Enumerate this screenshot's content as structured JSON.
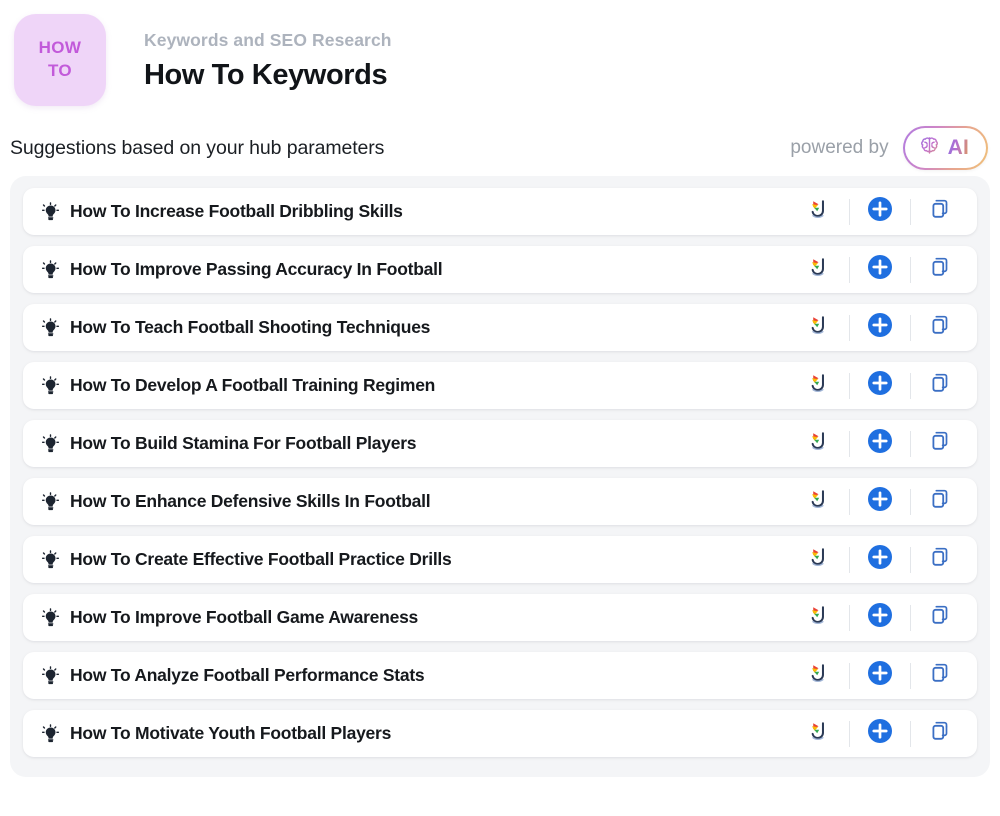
{
  "header": {
    "badge_line1": "HOW",
    "badge_line2": "TO",
    "eyebrow": "Keywords and SEO Research",
    "title": "How To Keywords",
    "badge_bg": "#efd5f8",
    "badge_text_color": "#c25ada"
  },
  "subheader": {
    "title": "Suggestions based on your hub parameters",
    "powered_by_label": "powered by",
    "ai_badge_text": "AI",
    "ai_icon": "brain-icon"
  },
  "list": {
    "row_icon": "lightbulb-icon",
    "actions": [
      {
        "name": "jasper-icon",
        "label": "Jasper"
      },
      {
        "name": "add-icon",
        "label": "Add"
      },
      {
        "name": "copy-icon",
        "label": "Copy"
      }
    ],
    "rows": [
      {
        "label": "How To Increase Football Dribbling Skills"
      },
      {
        "label": "How To Improve Passing Accuracy In Football"
      },
      {
        "label": "How To Teach Football Shooting Techniques"
      },
      {
        "label": "How To Develop A Football Training Regimen"
      },
      {
        "label": "How To Build Stamina For Football Players"
      },
      {
        "label": "How To Enhance Defensive Skills In Football"
      },
      {
        "label": "How To Create Effective Football Practice Drills"
      },
      {
        "label": "How To Improve Football Game Awareness"
      },
      {
        "label": "How To Analyze Football Performance Stats"
      },
      {
        "label": "How To Motivate Youth Football Players"
      }
    ]
  },
  "colors": {
    "accent_blue": "#1f6fe0",
    "panel_bg": "#f4f5f7",
    "row_bg": "#ffffff",
    "muted_text": "#9aa0a8"
  }
}
